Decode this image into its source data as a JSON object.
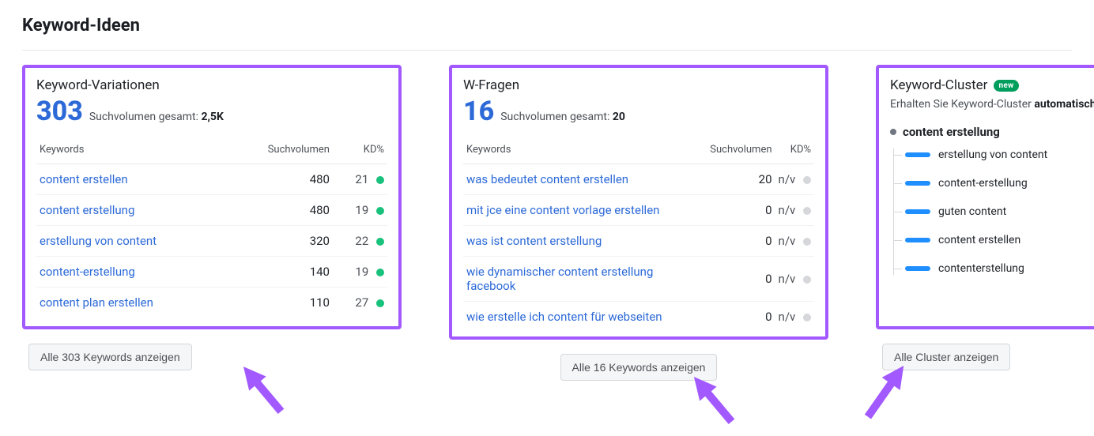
{
  "page": {
    "title": "Keyword-Ideen"
  },
  "columns": {
    "keywords": "Keywords",
    "volume": "Suchvolumen",
    "kd": "KD%"
  },
  "variations": {
    "title": "Keyword-Variationen",
    "count": "303",
    "volume_label": "Suchvolumen gesamt:",
    "volume_total": "2,5K",
    "rows": [
      {
        "kw": "content erstellen",
        "vol": "480",
        "kd": "21",
        "dot": "green"
      },
      {
        "kw": "content erstellung",
        "vol": "480",
        "kd": "19",
        "dot": "green"
      },
      {
        "kw": "erstellung von content",
        "vol": "320",
        "kd": "22",
        "dot": "green"
      },
      {
        "kw": "content-erstellung",
        "vol": "140",
        "kd": "19",
        "dot": "green"
      },
      {
        "kw": "content plan erstellen",
        "vol": "110",
        "kd": "27",
        "dot": "green"
      }
    ],
    "button": "Alle 303 Keywords anzeigen"
  },
  "questions": {
    "title": "W-Fragen",
    "count": "16",
    "volume_label": "Suchvolumen gesamt:",
    "volume_total": "20",
    "rows": [
      {
        "kw": "was bedeutet content erstellen",
        "vol": "20",
        "kd": "n/v",
        "dot": "gray"
      },
      {
        "kw": "mit jce eine content vorlage erstellen",
        "vol": "0",
        "kd": "n/v",
        "dot": "gray"
      },
      {
        "kw": "was ist content erstellung",
        "vol": "0",
        "kd": "n/v",
        "dot": "gray"
      },
      {
        "kw": "wie dynamischer content erstellung facebook",
        "vol": "0",
        "kd": "n/v",
        "dot": "gray"
      },
      {
        "kw": "wie erstelle ich content für webseiten",
        "vol": "0",
        "kd": "n/v",
        "dot": "gray"
      }
    ],
    "button": "Alle 16 Keywords anzeigen"
  },
  "cluster": {
    "title": "Keyword-Cluster",
    "badge": "new",
    "desc_prefix": "Erhalten Sie Keyword-Cluster ",
    "desc_bold": "automatisch",
    "root": "content erstellung",
    "children": [
      {
        "label": "erstellung von content",
        "bar": 32
      },
      {
        "label": "content-erstellung",
        "bar": 32
      },
      {
        "label": "guten content",
        "bar": 32
      },
      {
        "label": "content erstellen",
        "bar": 32
      },
      {
        "label": "contenterstellung",
        "bar": 32
      }
    ],
    "button": "Alle Cluster anzeigen"
  }
}
